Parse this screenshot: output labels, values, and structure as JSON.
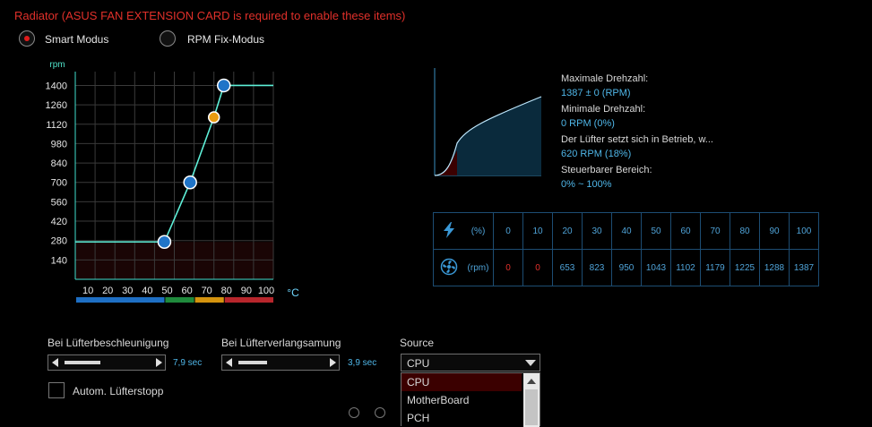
{
  "warning": "Radiator (ASUS FAN EXTENSION CARD is required to enable these items)",
  "modes": [
    {
      "label": "Smart Modus",
      "selected": true
    },
    {
      "label": "RPM Fix-Modus",
      "selected": false
    }
  ],
  "chart_data": {
    "type": "line",
    "ylabel": "rpm",
    "xlabel": "°C",
    "x_ticks": [
      10,
      20,
      30,
      40,
      50,
      60,
      70,
      80,
      90,
      100
    ],
    "y_ticks": [
      140,
      280,
      420,
      560,
      700,
      840,
      980,
      1120,
      1260,
      1400
    ],
    "xlim": [
      0,
      100
    ],
    "ylim": [
      0,
      1500
    ],
    "series": [
      {
        "values_x": [
          0,
          45,
          58,
          70,
          75,
          100
        ],
        "values_y": [
          270,
          270,
          700,
          1170,
          1400,
          1400
        ]
      }
    ],
    "points": [
      {
        "x": 45,
        "y": 270,
        "color": "#1f74c8"
      },
      {
        "x": 58,
        "y": 700,
        "color": "#1f74c8"
      },
      {
        "x": 70,
        "y": 1170,
        "color": "#e89b10"
      },
      {
        "x": 75,
        "y": 1400,
        "color": "#1f74c8"
      }
    ],
    "temperature_bands": [
      {
        "from": 0,
        "to": 45,
        "color": "#1e6fc4"
      },
      {
        "from": 45,
        "to": 60,
        "color": "#1f8a3c"
      },
      {
        "from": 60,
        "to": 75,
        "color": "#d4930e"
      },
      {
        "from": 75,
        "to": 100,
        "color": "#b8262c"
      }
    ]
  },
  "stats": {
    "max_label": "Maximale Drehzahl:",
    "max_value": "1387 ± 0 (RPM)",
    "min_label": "Minimale Drehzahl:",
    "min_value": "0 RPM (0%)",
    "start_label": "Der Lüfter setzt sich in Betrieb, w...",
    "start_value": "620 RPM (18%)",
    "range_label": "Steuerbarer Bereich:",
    "range_value": "0% ~ 100%"
  },
  "table": {
    "pct_unit": "(%)",
    "rpm_unit": "(rpm)",
    "percents": [
      "0",
      "10",
      "20",
      "30",
      "40",
      "50",
      "60",
      "70",
      "80",
      "90",
      "100"
    ],
    "rpms": [
      "0",
      "0",
      "653",
      "823",
      "950",
      "1043",
      "1102",
      "1179",
      "1225",
      "1288",
      "1387"
    ]
  },
  "controls": {
    "accel_label": "Bei Lüfterbeschleunigung",
    "accel_value": "7,9 sec",
    "decel_label": "Bei Lüfterverlangsamung",
    "decel_value": "3,9 sec",
    "source_label": "Source",
    "source_value": "CPU",
    "source_options": [
      "CPU",
      "MotherBoard",
      "PCH"
    ],
    "autostop_label": "Autom. Lüfterstopp"
  }
}
